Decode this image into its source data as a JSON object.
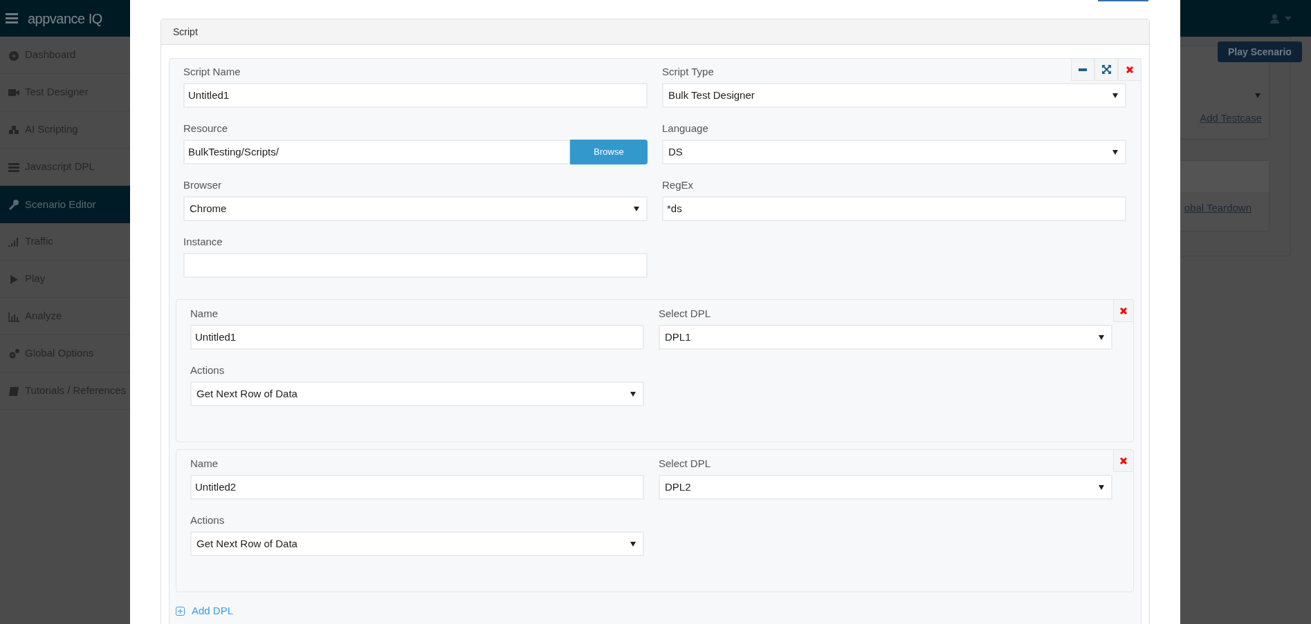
{
  "app": {
    "logo": "appvance IQ"
  },
  "sidebar": {
    "items": [
      {
        "label": "Dashboard",
        "kind": "dashboard",
        "selected": false
      },
      {
        "label": "Test Designer",
        "kind": "camera",
        "selected": false
      },
      {
        "label": "AI Scripting",
        "kind": "cubes",
        "selected": false
      },
      {
        "label": "Javascript DPL",
        "kind": "list",
        "selected": false
      },
      {
        "label": "Scenario Editor",
        "kind": "wrench",
        "selected": true
      },
      {
        "label": "Traffic",
        "kind": "signal",
        "selected": false
      },
      {
        "label": "Play",
        "kind": "play",
        "selected": false
      },
      {
        "label": "Analyze",
        "kind": "chart",
        "selected": false
      },
      {
        "label": "Global Options",
        "kind": "gears",
        "selected": false
      },
      {
        "label": "Tutorials / References",
        "kind": "book",
        "selected": false
      }
    ]
  },
  "background": {
    "play_button": "Play Scenario",
    "add_testcase_link": "Add Testcase",
    "teardown_link": "obal Teardown"
  },
  "script_panel": {
    "title": "Script",
    "fields": [
      {
        "label": "Script Name",
        "kind": "text",
        "value": "Untitled1"
      },
      {
        "label": "Script Type",
        "kind": "select",
        "value": "Bulk Test Designer"
      },
      {
        "label": "Resource",
        "kind": "browse",
        "value": "BulkTesting/Scripts/",
        "button": "Browse"
      },
      {
        "label": "Language",
        "kind": "select",
        "value": "DS"
      },
      {
        "label": "Browser",
        "kind": "select",
        "value": "Chrome"
      },
      {
        "label": "RegEx",
        "kind": "text",
        "value": "*ds"
      },
      {
        "label": "Instance",
        "kind": "text"
      }
    ],
    "dpls": [
      {
        "name_label": "Name",
        "name": "Untitled1",
        "dpl_label": "Select DPL",
        "dpl": "DPL1",
        "actions_label": "Actions",
        "action": "Get Next Row of Data"
      },
      {
        "name_label": "Name",
        "name": "Untitled2",
        "dpl_label": "Select DPL",
        "dpl": "DPL2",
        "actions_label": "Actions",
        "action": "Get Next Row of Data"
      }
    ],
    "add_dpl": "Add DPL"
  }
}
